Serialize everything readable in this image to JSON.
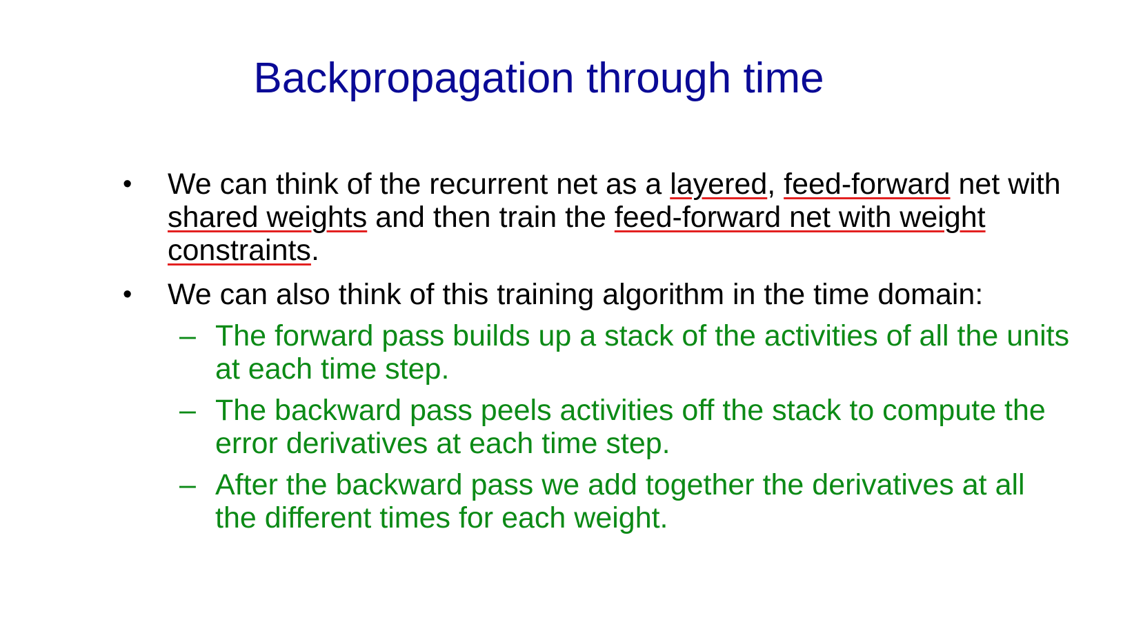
{
  "title": "Backpropagation through time",
  "bullets": [
    {
      "marker": "•",
      "parts": [
        "We can think of the recurrent net as a ",
        "layered",
        ", ",
        "feed-forward",
        " net with ",
        "shared weights",
        " and then train the ",
        "feed-forward net with weight constraints",
        "."
      ]
    },
    {
      "marker": "•",
      "text": "We can also think of this training algorithm in the time domain:",
      "subitems": [
        {
          "marker": "–",
          "text": "The forward pass builds up a stack of the activities of all the units at each time step."
        },
        {
          "marker": "–",
          "text": "The backward pass peels activities off the stack to compute the error derivatives at each time step."
        },
        {
          "marker": "–",
          "text": "After the backward pass we add together the derivatives at all the different times for each weight."
        }
      ]
    }
  ],
  "colors": {
    "title": "#0a0a96",
    "body": "#000000",
    "sub": "#0c8a16",
    "underline": "#e32020"
  }
}
